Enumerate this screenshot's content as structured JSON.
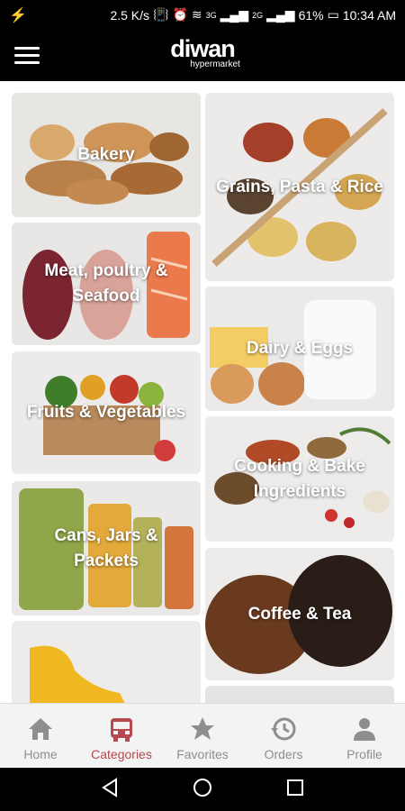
{
  "status_bar": {
    "network_speed": "2.5 K/s",
    "signal_1": "3G",
    "signal_2": "2G",
    "battery": "61%",
    "time": "10:34 AM"
  },
  "header": {
    "brand": "diwan",
    "brand_sub": "hypermarket"
  },
  "categories": [
    {
      "label": "Bakery"
    },
    {
      "label": "Grains, Pasta & Rice"
    },
    {
      "label": "Meat, poultry & Seafood"
    },
    {
      "label": "Dairy & Eggs"
    },
    {
      "label": "Fruits & Vegetables"
    },
    {
      "label": "Cooking & Bake Ingredients"
    },
    {
      "label": "Cans, Jars & Packets"
    },
    {
      "label": "Coffee & Tea"
    },
    {
      "label": ""
    },
    {
      "label": ""
    }
  ],
  "bottom_nav": [
    {
      "label": "Home",
      "icon": "home-icon"
    },
    {
      "label": "Categories",
      "icon": "bus-icon"
    },
    {
      "label": "Favorites",
      "icon": "star-icon"
    },
    {
      "label": "Orders",
      "icon": "history-icon"
    },
    {
      "label": "Profile",
      "icon": "person-icon"
    }
  ],
  "colors": {
    "active": "#b5494f",
    "inactive": "#8e8e8e",
    "tile_bg": "#e4e4e4"
  }
}
